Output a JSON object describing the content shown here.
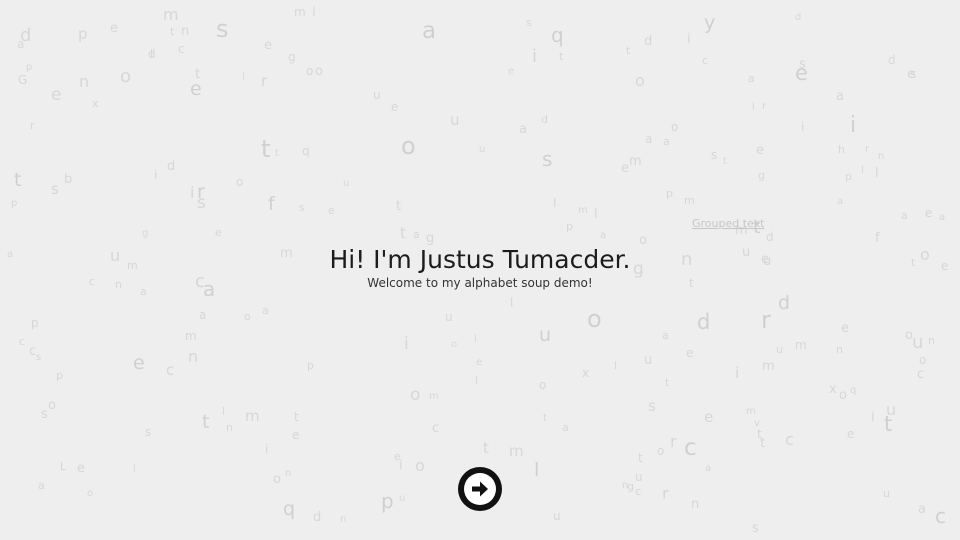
{
  "hero": {
    "title": "Hi! I'm Justus Tumacder.",
    "subtitle": "Welcome to my alphabet soup demo!"
  },
  "grouped_link": "Grouped text",
  "next_button": {
    "icon": "arrow-right-circle-icon"
  },
  "colors": {
    "background": "#eeeeee",
    "soup_letters": "#d4d4d4",
    "title_text": "#1c1c1c",
    "button": "#111111"
  },
  "soup_letters": [
    "e",
    "u",
    "r",
    "l",
    "t",
    "u",
    "f",
    "t",
    "i",
    "o",
    "o",
    "m",
    "t",
    "a",
    "u",
    "l",
    "t",
    "e",
    "x",
    "m",
    "c",
    "c",
    "m",
    "e",
    "t",
    "o",
    "c",
    "n",
    "t",
    "s",
    "m",
    "l",
    "n",
    "d",
    "p",
    "o",
    "c",
    "g",
    "l",
    "m",
    "o",
    "p",
    "l",
    "n",
    "u",
    "e",
    "t",
    "r",
    "m",
    "a",
    "a",
    "u",
    "h",
    "p",
    "t",
    "q",
    "u",
    "t",
    "i",
    "c",
    "n",
    "t",
    "e",
    "i",
    "c",
    "l",
    "b",
    "n",
    "l",
    "d",
    "o",
    "m",
    "v",
    "c",
    "o",
    "t",
    "e",
    "i",
    "r",
    "c",
    "o",
    "g",
    "s",
    "a",
    "f",
    "m",
    "i",
    "e",
    "d",
    "t",
    "x",
    "s",
    "p",
    "G",
    "u",
    "l",
    "s",
    "p",
    "r",
    "i",
    "g",
    "o",
    "l",
    "a",
    "u",
    "t",
    "d",
    "s",
    "m",
    "e",
    "m",
    "i",
    "e",
    "n",
    "r",
    "c",
    "a",
    "t",
    "q",
    "p",
    "t",
    "d",
    "u",
    "d",
    "i",
    "g",
    "l",
    "s",
    "i",
    "t",
    "s",
    "a",
    "e",
    "o",
    "y",
    "t",
    "i",
    "o",
    "p",
    "t",
    "o",
    "l",
    "e",
    "c",
    "e",
    "n",
    "u",
    "r",
    "l",
    "q",
    "n",
    "e",
    "m",
    "a",
    "c",
    "a",
    "o",
    "u",
    "e",
    "e",
    "o",
    "a",
    "n",
    "m",
    "d",
    "s",
    "t",
    "x",
    "s",
    "a",
    "a",
    "i",
    "u",
    "r",
    "e",
    "o",
    "q",
    "a",
    "l",
    "a",
    "L",
    "d",
    "c",
    "u",
    "t",
    "s",
    "o",
    "a",
    "e",
    "u",
    "a",
    "o",
    "a",
    "d",
    "r",
    "n",
    "i",
    "a",
    "g",
    "u",
    "e",
    "a",
    "n",
    "t",
    "t",
    "e",
    "m",
    "m",
    "a",
    "n",
    "s",
    "g",
    "p",
    "n",
    "s",
    "c",
    "e",
    "d",
    "o",
    "a",
    "e",
    "u",
    "s",
    "u",
    "p",
    "o",
    "e",
    "o",
    "o",
    "d",
    "l",
    "e",
    "m",
    "e",
    "o",
    "a",
    "s",
    "p"
  ]
}
